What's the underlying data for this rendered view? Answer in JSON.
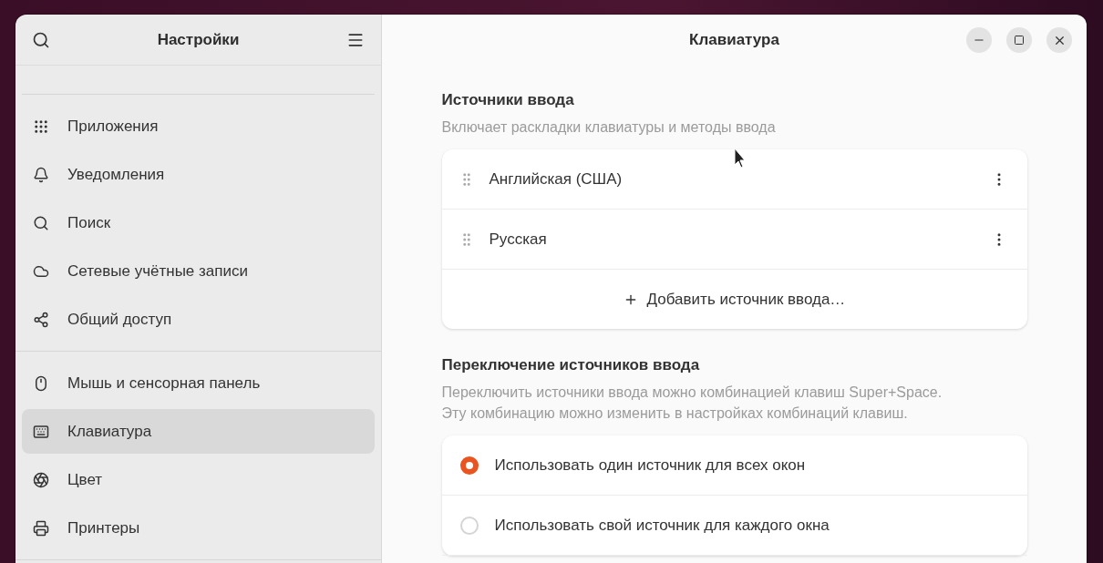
{
  "sidebar": {
    "title": "Настройки",
    "groups": [
      [
        {
          "label": "Приложения",
          "selected": false
        },
        {
          "label": "Уведомления",
          "selected": false
        },
        {
          "label": "Поиск",
          "selected": false
        },
        {
          "label": "Сетевые учётные записи",
          "selected": false
        },
        {
          "label": "Общий доступ",
          "selected": false
        }
      ],
      [
        {
          "label": "Мышь и сенсорная панель",
          "selected": false
        },
        {
          "label": "Клавиатура",
          "selected": true
        },
        {
          "label": "Цвет",
          "selected": false
        },
        {
          "label": "Принтеры",
          "selected": false
        }
      ]
    ]
  },
  "content": {
    "title": "Клавиатура",
    "input_sources": {
      "heading": "Источники ввода",
      "description": "Включает раскладки клавиатуры и методы ввода",
      "sources": [
        "Английская (США)",
        "Русская"
      ],
      "add_button": "Добавить источник ввода…"
    },
    "switching": {
      "heading": "Переключение источников ввода",
      "description": [
        "Переключить источники ввода можно комбинацией клавиш Super+Space.",
        "Эту комбинацию можно изменить в настройках комбинаций клавиш."
      ],
      "options": [
        {
          "label": "Использовать один источник для всех окон",
          "selected": true
        },
        {
          "label": "Использовать свой источник для каждого окна",
          "selected": false
        }
      ]
    }
  }
}
